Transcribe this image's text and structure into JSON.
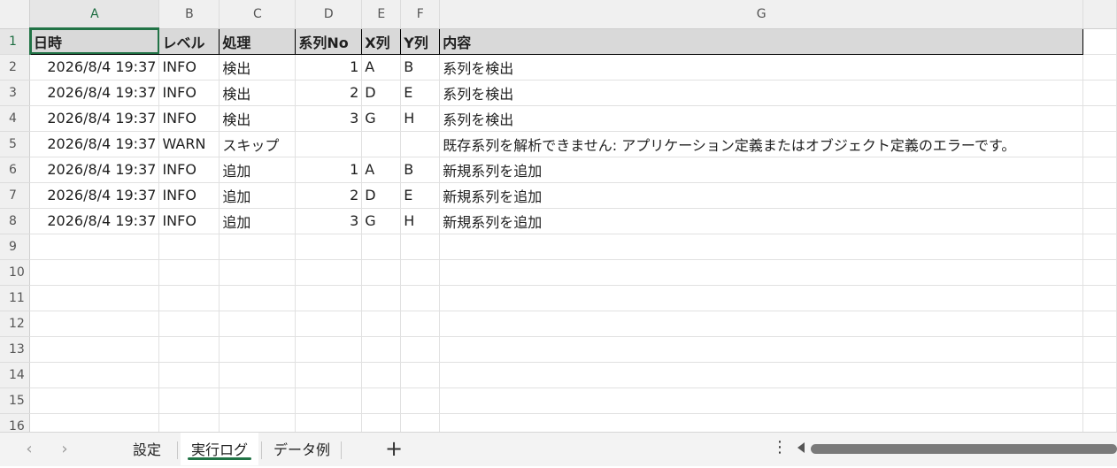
{
  "columns": [
    "A",
    "B",
    "C",
    "D",
    "E",
    "F",
    "G"
  ],
  "rows": [
    {
      "num": "1",
      "cells": [
        "日時",
        "レベル",
        "処理",
        "系列No",
        "X列",
        "Y列",
        "内容"
      ]
    },
    {
      "num": "2",
      "cells": [
        "2026/8/4 19:37",
        "INFO",
        "検出",
        "1",
        "A",
        "B",
        "系列を検出"
      ]
    },
    {
      "num": "3",
      "cells": [
        "2026/8/4 19:37",
        "INFO",
        "検出",
        "2",
        "D",
        "E",
        "系列を検出"
      ]
    },
    {
      "num": "4",
      "cells": [
        "2026/8/4 19:37",
        "INFO",
        "検出",
        "3",
        "G",
        "H",
        "系列を検出"
      ]
    },
    {
      "num": "5",
      "cells": [
        "2026/8/4 19:37",
        "WARN",
        "スキップ",
        "",
        "",
        "",
        "既存系列を解析できません: アプリケーション定義またはオブジェクト定義のエラーです。"
      ]
    },
    {
      "num": "6",
      "cells": [
        "2026/8/4 19:37",
        "INFO",
        "追加",
        "1",
        "A",
        "B",
        "新規系列を追加"
      ]
    },
    {
      "num": "7",
      "cells": [
        "2026/8/4 19:37",
        "INFO",
        "追加",
        "2",
        "D",
        "E",
        "新規系列を追加"
      ]
    },
    {
      "num": "8",
      "cells": [
        "2026/8/4 19:37",
        "INFO",
        "追加",
        "3",
        "G",
        "H",
        "新規系列を追加"
      ]
    },
    {
      "num": "9",
      "cells": [
        "",
        "",
        "",
        "",
        "",
        "",
        ""
      ]
    },
    {
      "num": "10",
      "cells": [
        "",
        "",
        "",
        "",
        "",
        "",
        ""
      ]
    },
    {
      "num": "11",
      "cells": [
        "",
        "",
        "",
        "",
        "",
        "",
        ""
      ]
    },
    {
      "num": "12",
      "cells": [
        "",
        "",
        "",
        "",
        "",
        "",
        ""
      ]
    },
    {
      "num": "13",
      "cells": [
        "",
        "",
        "",
        "",
        "",
        "",
        ""
      ]
    },
    {
      "num": "14",
      "cells": [
        "",
        "",
        "",
        "",
        "",
        "",
        ""
      ]
    },
    {
      "num": "15",
      "cells": [
        "",
        "",
        "",
        "",
        "",
        "",
        ""
      ]
    },
    {
      "num": "16",
      "cells": [
        "",
        "",
        "",
        "",
        "",
        "",
        ""
      ]
    }
  ],
  "sheets": {
    "tabs": [
      "設定",
      "実行ログ",
      "データ例"
    ],
    "active": "実行ログ",
    "nav_prev": "‹",
    "nav_next": "›",
    "add": "+",
    "more": "⋮"
  },
  "colors": {
    "accent": "#217346",
    "header_fill": "#d9d9d9"
  }
}
